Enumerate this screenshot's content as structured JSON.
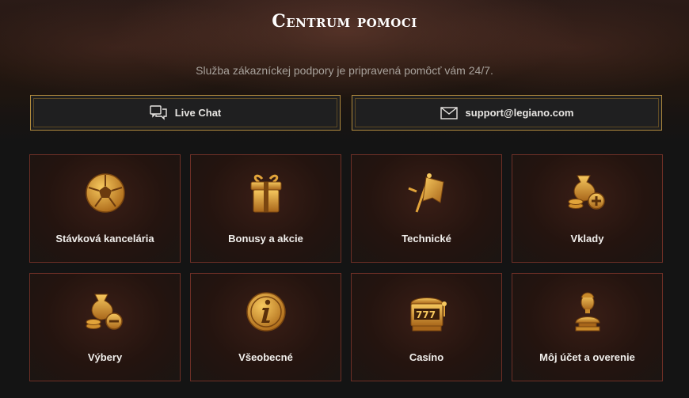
{
  "header": {
    "title": "Centrum pomoci",
    "subtitle": "Služba zákazníckej podpory je pripravená pomôcť vám 24/7."
  },
  "contacts": [
    {
      "label": "Live Chat",
      "icon": "chat-icon"
    },
    {
      "label": "support@legiano.com",
      "icon": "mail-icon"
    }
  ],
  "categories": [
    {
      "label": "Stávková kancelária",
      "icon": "soccer-ball-icon"
    },
    {
      "label": "Bonusy a akcie",
      "icon": "gift-box-icon"
    },
    {
      "label": "Technické",
      "icon": "banner-standard-icon"
    },
    {
      "label": "Vklady",
      "icon": "money-bag-plus-icon"
    },
    {
      "label": "Výbery",
      "icon": "money-bag-minus-icon"
    },
    {
      "label": "Všeobecné",
      "icon": "info-coin-icon"
    },
    {
      "label": "Casíno",
      "icon": "slot-machine-icon"
    },
    {
      "label": "Môj účet a overenie",
      "icon": "bust-statue-icon"
    }
  ],
  "colors": {
    "gold": "#e2a43a",
    "border_gold": "#b08a3e",
    "card_border": "#6e2f26",
    "background": "#141414"
  }
}
